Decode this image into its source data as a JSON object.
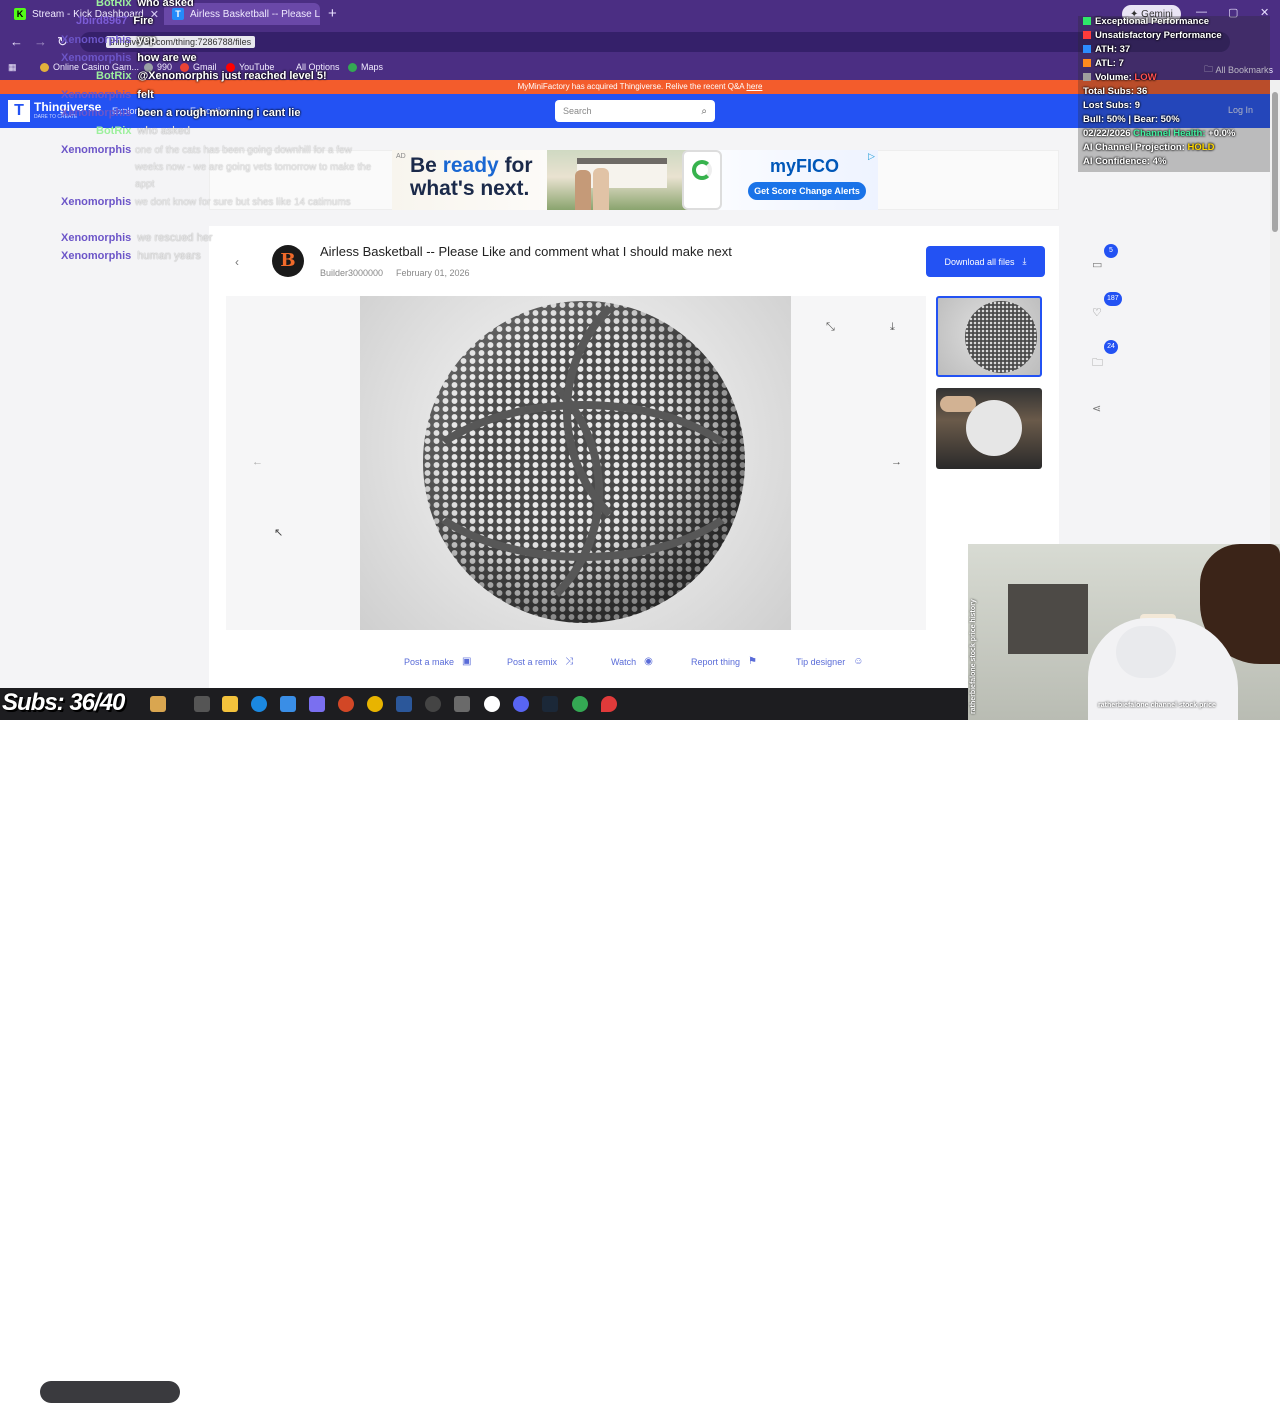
{
  "browser": {
    "tabs": [
      {
        "title": "Stream - Kick Dashboard",
        "favicon": "K"
      },
      {
        "title": "Airless Basketball -- Please Like",
        "favicon": "T"
      }
    ],
    "gemini_label": "Gemini",
    "url": "thingiverse.com/thing:7286788/files",
    "bookmarks": [
      "Online Casino Gam...",
      "990",
      "Gmail",
      "YouTube",
      "All Options",
      "Maps"
    ],
    "all_bookmarks": "All Bookmarks"
  },
  "site": {
    "announcement_text": "MyMiniFactory has acquired Thingiverse. Relive the recent Q&A",
    "announcement_link": "here",
    "logo_name": "Thingiverse",
    "logo_letter": "T",
    "logo_tagline": "DARE TO CREATE",
    "nav": [
      "Explore",
      "Education"
    ],
    "search_placeholder": "Search",
    "login": "Log In"
  },
  "ad": {
    "label": "AD",
    "headline_1": "Be ",
    "headline_highlight": "ready",
    "headline_2": " for",
    "headline_3": "what's next.",
    "brand": "myFICO",
    "cta": "Get Score Change Alerts"
  },
  "thing": {
    "avatar_letter": "B",
    "title": "Airless Basketball -- Please Like and comment what I should make next",
    "author": "Builder3000000",
    "date": "February 01, 2026",
    "download_label": "Download all files",
    "actions": [
      {
        "label": "Post a make",
        "icon": "camera-icon"
      },
      {
        "label": "Post a remix",
        "icon": "shuffle-icon"
      },
      {
        "label": "Watch",
        "icon": "eye-icon"
      },
      {
        "label": "Report thing",
        "icon": "flag-icon"
      },
      {
        "label": "Tip designer",
        "icon": "smile-icon"
      }
    ],
    "stats": {
      "comments": "5",
      "likes": "187",
      "collections": "24"
    }
  },
  "chat": [
    {
      "user": "BotRix",
      "msg": "who asked"
    },
    {
      "user": "Jbird8967",
      "msg": "Fire"
    },
    {
      "user": "Xenomorphis",
      "msg": "yep"
    },
    {
      "user": "Xenomorphis",
      "msg": "how are we"
    },
    {
      "user": "BotRix",
      "msg": "@Xenomorphis just reached level 5!"
    },
    {
      "user": "Xenomorphis",
      "msg": "felt"
    },
    {
      "user": "Xenomorphis",
      "msg": "been a rough morning i cant lie"
    },
    {
      "user": "BotRix",
      "msg": "who asked"
    },
    {
      "user": "Xenomorphis",
      "msg": "one of the cats has been going downhill for a few weeks now - we are going vets tomorrow to make the appt"
    },
    {
      "user": "Xenomorphis",
      "msg": "we dont know for sure but shes like 14 catimums"
    },
    {
      "user": "Xenomorphis",
      "msg": "we rescued her"
    },
    {
      "user": "Xenomorphis",
      "msg": "human years"
    }
  ],
  "overlay_stats": {
    "exceptional": "Exceptional Performance",
    "unsatisfactory": "Unsatisfactory Performance",
    "ath": "ATH: 37",
    "atl": "ATL: 7",
    "volume_label": "Volume: ",
    "volume_value": "LOW",
    "total_subs": "Total Subs: 36",
    "lost_subs": "Lost Subs: 9",
    "bull_bear": "Bull: 50% | Bear: 50%",
    "date": "02/22/2026",
    "channel_health_label": " Channel Health: ",
    "channel_health_value": "+0.0%",
    "projection_label": "AI Channel Projection: ",
    "projection_value": "HOLD",
    "confidence": "AI Confidence: 4%",
    "colors": {
      "exceptional": "#2ee86a",
      "unsatisfactory": "#ff3b3b",
      "ath": "#2c8cff",
      "atl": "#ff8a1e",
      "volume": "#9e9e9e"
    }
  },
  "webcam": {
    "side_text": "ratherbiefalone stock price history",
    "bottom_text": "ratherbiefalone channel stock price"
  },
  "subs_overlay": "Subs: 36/40"
}
